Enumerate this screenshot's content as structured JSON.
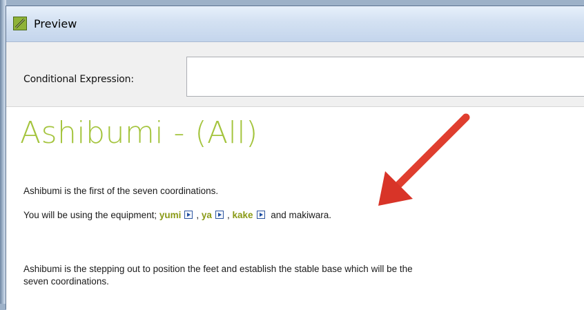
{
  "window": {
    "title": "Preview",
    "app_icon": "pencil-app-icon"
  },
  "toolbar": {
    "conditional_label": "Conditional Expression:",
    "conditional_value": ""
  },
  "content": {
    "heading": "Ashibumi - (All)",
    "para1": "Ashibumi is the first of the seven coordinations.",
    "para2": {
      "prefix": "You will be using the equipment; ",
      "terms": [
        "yumi",
        "ya",
        "kake"
      ],
      "sep": ", ",
      "suffix": " and makiwara."
    },
    "para3_line1": "Ashibumi is the stepping out to position the feet and establish the stable base which will be the",
    "para3_line2": "seven coordinations."
  },
  "annotation": {
    "arrow_color": "#e23b2e"
  },
  "colors": {
    "heading": "#a4c43d",
    "term": "#8a9a16",
    "play_icon": "#1f4ea1"
  }
}
